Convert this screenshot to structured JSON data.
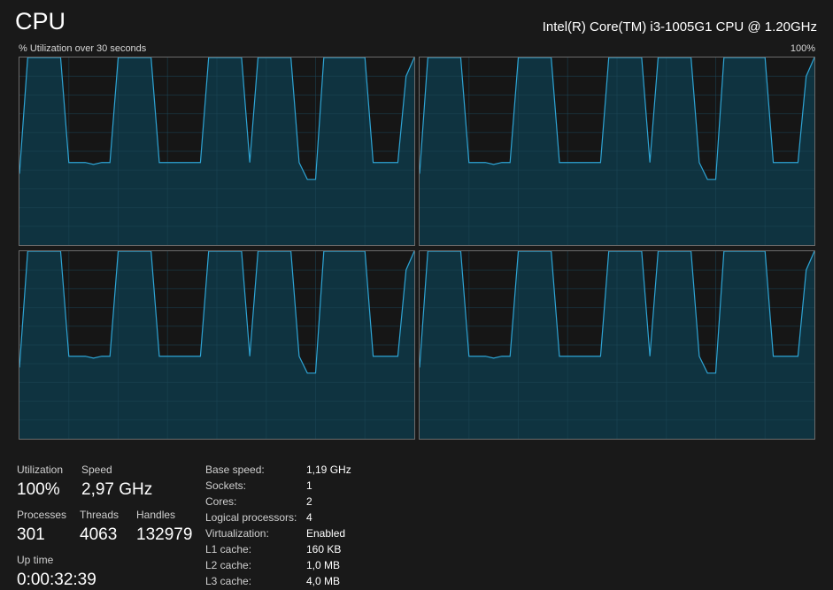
{
  "header": {
    "title": "CPU",
    "cpu_name": "Intel(R) Core(TM) i3-1005G1 CPU @ 1.20GHz"
  },
  "graphs": {
    "label": "% Utilization over 30 seconds",
    "max_label": "100%",
    "line_color": "#2ea4d4",
    "fill_color": "#0f3340",
    "grid_color": "#1d4556",
    "border_color": "#6b6b6b",
    "cores": [
      {
        "name": "logical-processor-0",
        "values": [
          38,
          100,
          100,
          100,
          100,
          100,
          44,
          44,
          44,
          43,
          44,
          44,
          100,
          100,
          100,
          100,
          100,
          44,
          44,
          44,
          44,
          44,
          44,
          100,
          100,
          100,
          100,
          100,
          44,
          100,
          100,
          100,
          100,
          100,
          44,
          35,
          35,
          100,
          100,
          100,
          100,
          100,
          100,
          44,
          44,
          44,
          44,
          90,
          100
        ]
      },
      {
        "name": "logical-processor-1",
        "values": [
          38,
          100,
          100,
          100,
          100,
          100,
          44,
          44,
          44,
          43,
          44,
          44,
          100,
          100,
          100,
          100,
          100,
          44,
          44,
          44,
          44,
          44,
          44,
          100,
          100,
          100,
          100,
          100,
          44,
          100,
          100,
          100,
          100,
          100,
          44,
          35,
          35,
          100,
          100,
          100,
          100,
          100,
          100,
          44,
          44,
          44,
          44,
          90,
          100
        ]
      },
      {
        "name": "logical-processor-2",
        "values": [
          38,
          100,
          100,
          100,
          100,
          100,
          44,
          44,
          44,
          43,
          44,
          44,
          100,
          100,
          100,
          100,
          100,
          44,
          44,
          44,
          44,
          44,
          44,
          100,
          100,
          100,
          100,
          100,
          44,
          100,
          100,
          100,
          100,
          100,
          44,
          35,
          35,
          100,
          100,
          100,
          100,
          100,
          100,
          44,
          44,
          44,
          44,
          90,
          100
        ]
      },
      {
        "name": "logical-processor-3",
        "values": [
          38,
          100,
          100,
          100,
          100,
          100,
          44,
          44,
          44,
          43,
          44,
          44,
          100,
          100,
          100,
          100,
          100,
          44,
          44,
          44,
          44,
          44,
          44,
          100,
          100,
          100,
          100,
          100,
          44,
          100,
          100,
          100,
          100,
          100,
          44,
          35,
          35,
          100,
          100,
          100,
          100,
          100,
          100,
          44,
          44,
          44,
          44,
          90,
          100
        ]
      }
    ]
  },
  "stats": {
    "utilization_label": "Utilization",
    "utilization_value": "100%",
    "speed_label": "Speed",
    "speed_value": "2,97 GHz",
    "processes_label": "Processes",
    "processes_value": "301",
    "threads_label": "Threads",
    "threads_value": "4063",
    "handles_label": "Handles",
    "handles_value": "132979",
    "uptime_label": "Up time",
    "uptime_value": "0:00:32:39"
  },
  "info": [
    {
      "key": "Base speed:",
      "value": "1,19 GHz"
    },
    {
      "key": "Sockets:",
      "value": "1"
    },
    {
      "key": "Cores:",
      "value": "2"
    },
    {
      "key": "Logical processors:",
      "value": "4"
    },
    {
      "key": "Virtualization:",
      "value": "Enabled"
    },
    {
      "key": "L1 cache:",
      "value": "160 KB"
    },
    {
      "key": "L2 cache:",
      "value": "1,0 MB"
    },
    {
      "key": "L3 cache:",
      "value": "4,0 MB"
    }
  ]
}
